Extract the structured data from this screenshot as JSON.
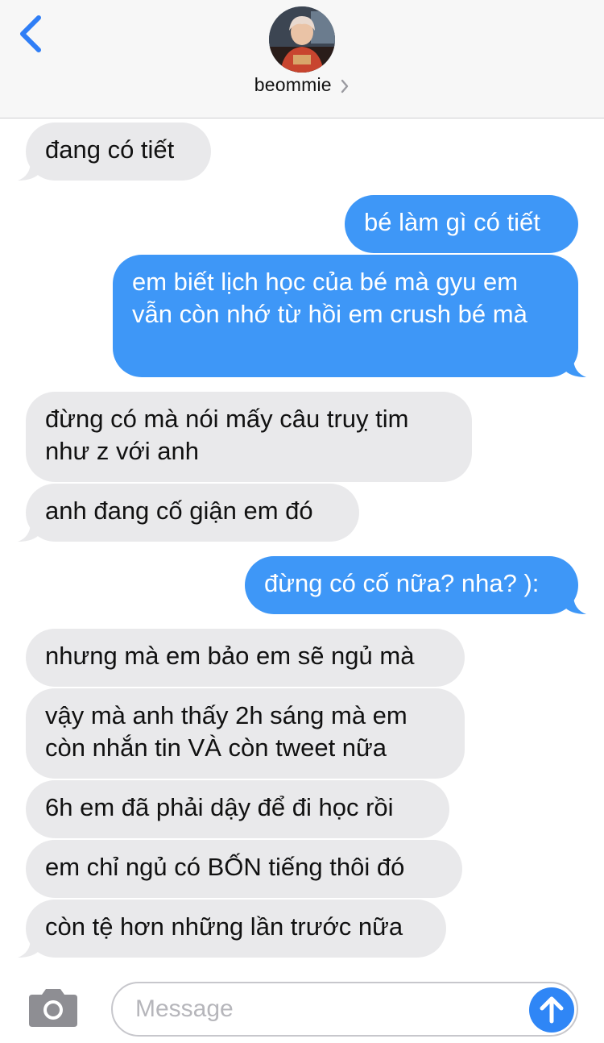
{
  "header": {
    "contact_name": "beommie",
    "back_icon": "chevron-left-icon",
    "accent_color": "#2f7ef6"
  },
  "messages": [
    {
      "direction": "received",
      "text": "đang có tiết"
    },
    {
      "direction": "sent",
      "text": "bé làm gì có tiết"
    },
    {
      "direction": "sent",
      "text": "em biết lịch học của bé mà gyu em vẫn còn nhớ từ hồi em crush bé mà"
    },
    {
      "direction": "received",
      "text": "đừng có mà nói mấy câu truỵ tim như z với anh"
    },
    {
      "direction": "received",
      "text": "anh đang cố giận em đó"
    },
    {
      "direction": "sent",
      "text": "đừng có cố nữa? nha? ):"
    },
    {
      "direction": "received",
      "text": "nhưng mà em bảo em sẽ ngủ mà"
    },
    {
      "direction": "received",
      "text": "vậy mà anh thấy 2h sáng mà em còn nhắn tin VÀ còn tweet nữa"
    },
    {
      "direction": "received",
      "text": "6h em đã phải dậy để đi học rồi"
    },
    {
      "direction": "received",
      "text": "em chỉ ngủ có BỐN tiếng thôi đó"
    },
    {
      "direction": "received",
      "text": "còn tệ hơn những lần trước nữa"
    }
  ],
  "composer": {
    "placeholder": "Message",
    "camera_icon": "camera-icon",
    "send_icon": "arrow-up-icon"
  },
  "colors": {
    "sent_bubble": "#3e97f7",
    "received_bubble": "#e9e9eb",
    "send_button": "#2f86f6"
  }
}
